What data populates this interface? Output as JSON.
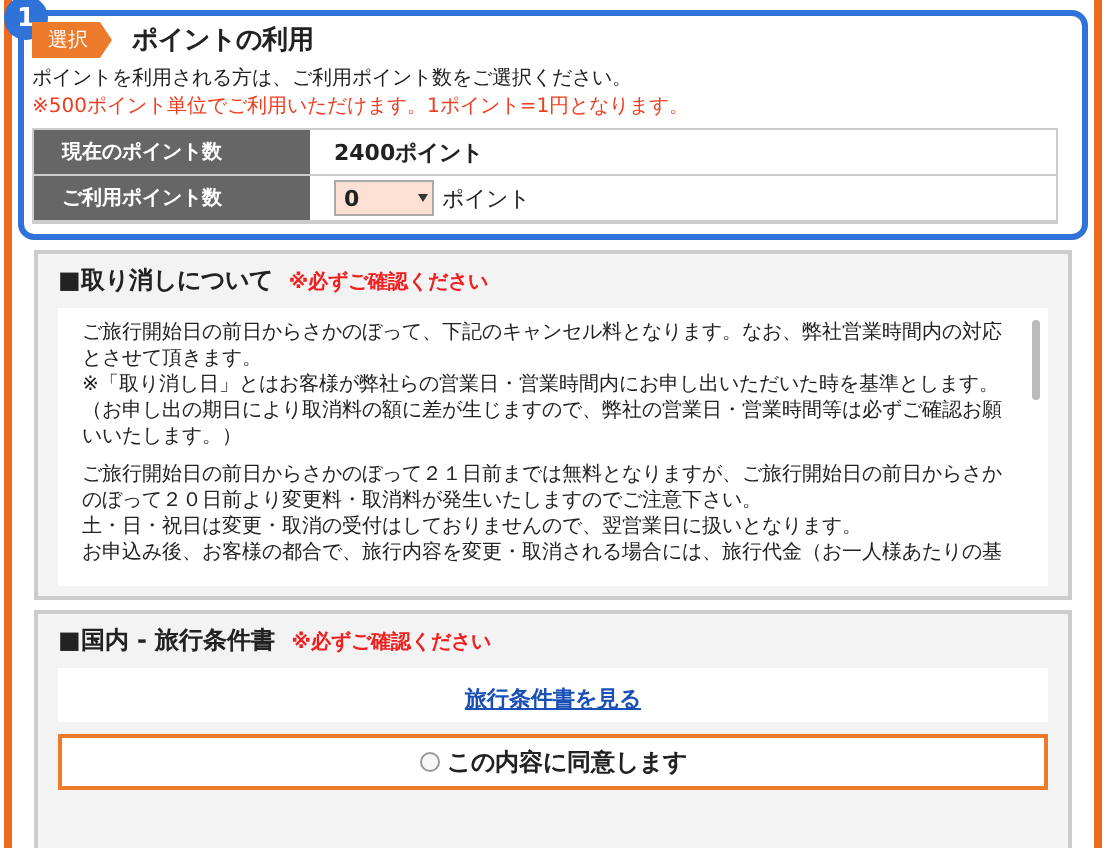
{
  "points": {
    "step": "1",
    "tag": "選択",
    "title": "ポイントの利用",
    "note": "ポイントを利用される方は、ご利用ポイント数をご選択ください。",
    "warning": "※500ポイント単位でご利用いただけます。1ポイント=1円となります。",
    "current": {
      "label": "現在のポイント数",
      "value": "2400ポイント"
    },
    "use": {
      "label": "ご利用ポイント数",
      "value": "0",
      "unit": "ポイント"
    }
  },
  "cancellation": {
    "title": "■取り消しについて",
    "notice": "※必ずご確認ください",
    "paragraphs": [
      [
        "ご旅行開始日の前日からさかのぼって、下記のキャンセル料となります。なお、弊社営業時間内の対応",
        "とさせて頂きます。",
        "※「取り消し日」とはお客様が弊社らの営業日・営業時間内にお申し出いただいた時を基準とします。",
        "（お申し出の期日により取消料の額に差が生じますので、弊社の営業日・営業時間等は必ずご確認お願",
        "いいたします。）"
      ],
      [
        "ご旅行開始日の前日からさかのぼって２１日前までは無料となりますが、ご旅行開始日の前日からさか",
        "のぼって２０日前より変更料・取消料が発生いたしますのでご注意下さい。",
        "土・日・祝日は変更・取消の受付はしておりませんので、翌営業日に扱いとなります。",
        "お申込み後、お客様の都合で、旅行内容を変更・取消される場合には、旅行代金（お一人様あたりの基"
      ]
    ]
  },
  "terms": {
    "title": "■国内 - 旅行条件書",
    "notice": "※必ずご確認ください",
    "link": "旅行条件書を見る",
    "agree": {
      "label": "この内容に同意します",
      "checked": false
    }
  }
}
